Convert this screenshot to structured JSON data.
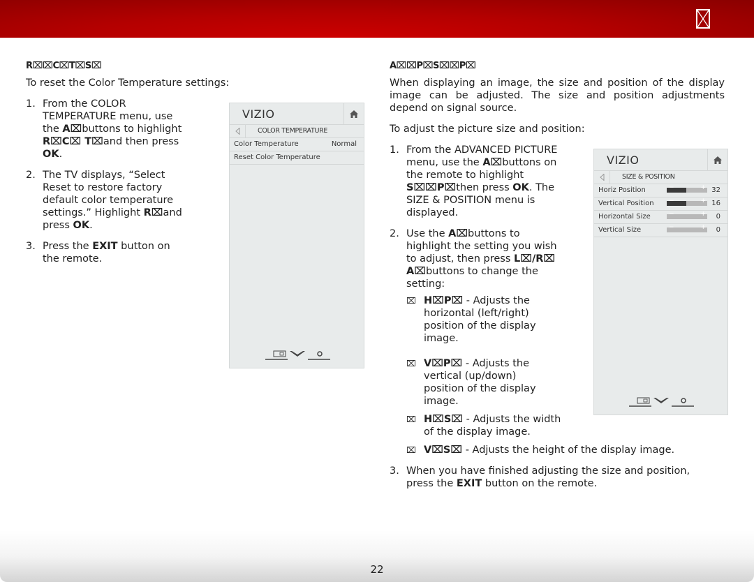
{
  "header": {
    "glyph_icon": "missing-glyph-box-icon"
  },
  "left": {
    "section_title": "R⌧⌧C⌧T⌧S⌧",
    "intro": "To reset the Color Temperature settings:",
    "steps": [
      {
        "num": "1.",
        "t1": "From the COLOR TEMPERATURE menu, use the ",
        "b1": "A⌧",
        "t2": "buttons to highlight ",
        "b2": "R⌧C⌧ T⌧",
        "t3": "and then press ",
        "b3": "OK",
        "t4": "."
      },
      {
        "num": "2.",
        "t1": "The TV displays, “Select Reset to restore factory default color temperature settings.” Highlight ",
        "b1": "R⌧",
        "t2": "and press ",
        "b2": "OK",
        "t3": "."
      },
      {
        "num": "3.",
        "t1": "Press the ",
        "b1": "EXIT",
        "t2": " button on the remote."
      }
    ],
    "tv": {
      "logo": "VIZIO",
      "subtitle": "COLOR TEMPERATURE",
      "rows": [
        {
          "label": "Color Temperature",
          "value": "Normal"
        },
        {
          "label": "Reset Color Temperature",
          "value": ""
        }
      ]
    }
  },
  "right": {
    "section_title": "A⌧⌧P⌧S⌧⌧P⌧",
    "intro": "When displaying an image, the size and position of the display image can be adjusted. The size and position adjustments depend on signal source.",
    "intro2": "To adjust the picture size and position:",
    "steps": [
      {
        "num": "1.",
        "t1": "From the ADVANCED PICTURE menu, use the ",
        "b1": "A⌧",
        "t2": "buttons on the remote to highlight ",
        "b2": "S⌧⌧P⌧",
        "t3": "then press ",
        "b3": "OK",
        "t4": ". The SIZE & POSITION menu is displayed."
      },
      {
        "num": "2.",
        "t1": "Use the ",
        "b1": "A⌧",
        "t2": "buttons to highlight the setting you wish to adjust, then press ",
        "b2": "L⌧/R⌧ A⌧",
        "t3": "buttons to change the setting:"
      },
      {
        "num": "3.",
        "t1": "When you have finished adjusting the size and position, press the ",
        "b1": "EXIT",
        "t2": " button on the remote."
      }
    ],
    "bullets": [
      {
        "mark": "⌧",
        "b": "H⌧P⌧",
        "t": " - Adjusts the horizontal (left/right) position of the display image."
      },
      {
        "mark": "⌧",
        "b": "V⌧P⌧",
        "t": " - Adjusts the vertical (up/down) position of the display image."
      },
      {
        "mark": "⌧",
        "b": "H⌧S⌧",
        "t": " - Adjusts the width of the display image."
      },
      {
        "mark": "⌧",
        "b": "V⌧S⌧",
        "t": " - Adjusts the height of the display image."
      }
    ],
    "tv": {
      "logo": "VIZIO",
      "subtitle": "SIZE & POSITION",
      "rows": [
        {
          "label": "Horiz Position",
          "value": "32",
          "fill_fraction": 0.48
        },
        {
          "label": "Vertical Position",
          "value": "16",
          "fill_fraction": 0.48
        },
        {
          "label": "Horizontal Size",
          "value": "0",
          "fill_fraction": 0
        },
        {
          "label": "Vertical Size",
          "value": "0",
          "fill_fraction": 0
        }
      ]
    }
  },
  "footer": {
    "page_number": "22"
  }
}
